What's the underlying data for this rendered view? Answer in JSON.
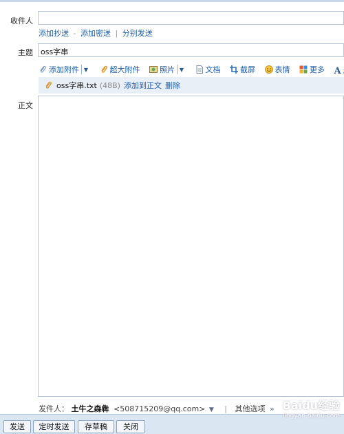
{
  "recipient": {
    "label": "收件人",
    "value": ""
  },
  "recipient_links": {
    "cc": "添加抄送",
    "bcc": "添加密送",
    "separate": "分别发送",
    "dash": "-",
    "bar": "|"
  },
  "subject": {
    "label": "主题",
    "value": "oss字串"
  },
  "toolbar": {
    "attach": "添加附件",
    "large_attach": "超大附件",
    "photo": "照片",
    "doc": "文档",
    "screenshot": "截屏",
    "emoji": "表情",
    "more": "更多",
    "format": "格式"
  },
  "attachment": {
    "name": "oss字串.txt",
    "size": "(48B)",
    "add_to_body": "添加到正文",
    "delete": "删除"
  },
  "body": {
    "label": "正文",
    "content": ""
  },
  "sender": {
    "label": "发件人：",
    "name": "土牛之森犇",
    "email": "<508715209@qq.com>",
    "bar": "|",
    "other_options": "其他选项"
  },
  "buttons": {
    "send": "发送",
    "scheduled": "定时发送",
    "draft": "存草稿",
    "close": "关闭"
  },
  "watermark": {
    "brand": "Baidu经验",
    "url": "jingyan.baidu.com"
  },
  "colors": {
    "link": "#1d5fa8",
    "attach_bar": "#e9eff7",
    "bottom_bar": "#dbe6f3",
    "field_border": "#b7c4d4"
  }
}
